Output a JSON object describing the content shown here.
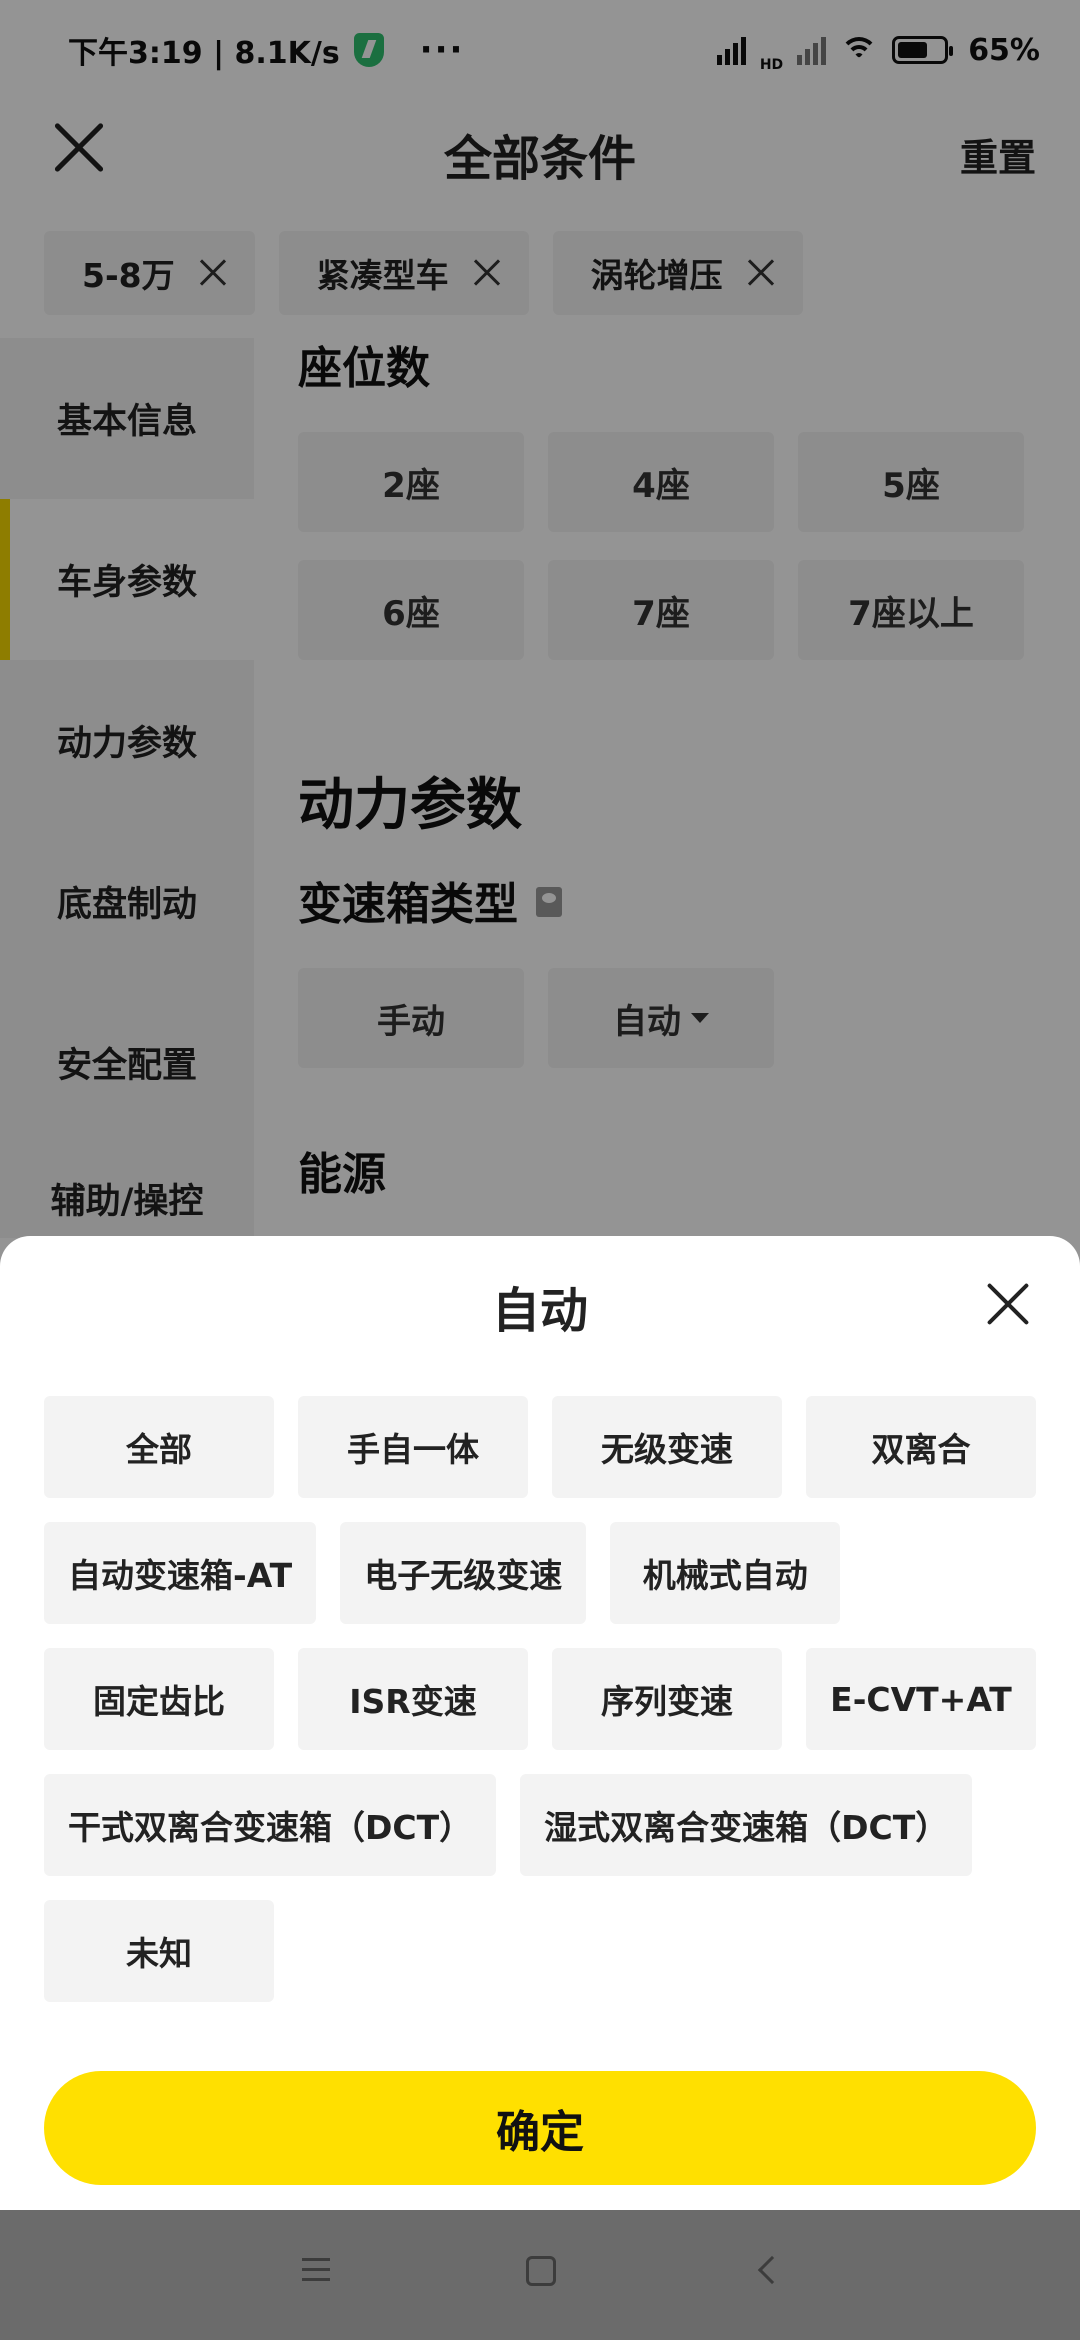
{
  "status_bar": {
    "time_speed": "下午3:19 | 8.1K/s",
    "more": "···",
    "hd": "HD",
    "battery": "65%"
  },
  "header": {
    "title": "全部条件",
    "reset_label": "重置"
  },
  "selected_tags": [
    "5-8万",
    "紧凑型车",
    "涡轮增压"
  ],
  "sidebar": {
    "items": [
      "基本信息",
      "车身参数",
      "动力参数",
      "底盘制动",
      "安全配置",
      "辅助/操控"
    ],
    "active_index": 1
  },
  "content": {
    "seats_title": "座位数",
    "seat_options": [
      "2座",
      "4座",
      "5座",
      "6座",
      "7座",
      "7座以上"
    ],
    "power_section_title": "动力参数",
    "gearbox_title": "变速箱类型",
    "gearbox_options": [
      "手动",
      "自动"
    ],
    "energy_title": "能源"
  },
  "sheet": {
    "title": "自动",
    "options": [
      "全部",
      "手自一体",
      "无级变速",
      "双离合",
      "自动变速箱-AT",
      "电子无级变速",
      "机械式自动",
      "固定齿比",
      "ISR变速",
      "序列变速",
      "E-CVT+AT",
      "干式双离合变速箱（DCT）",
      "湿式双离合变速箱（DCT）",
      "未知"
    ],
    "confirm_label": "确定"
  },
  "colors": {
    "accent_yellow": "#FFE000",
    "chip_bg": "#F3F3F3",
    "overlay": "rgba(0,0,0,0.42)"
  },
  "icons": {
    "close": "close-icon",
    "remove_tag": "x-icon",
    "info": "book-icon",
    "dropdown": "caret-down-icon"
  }
}
